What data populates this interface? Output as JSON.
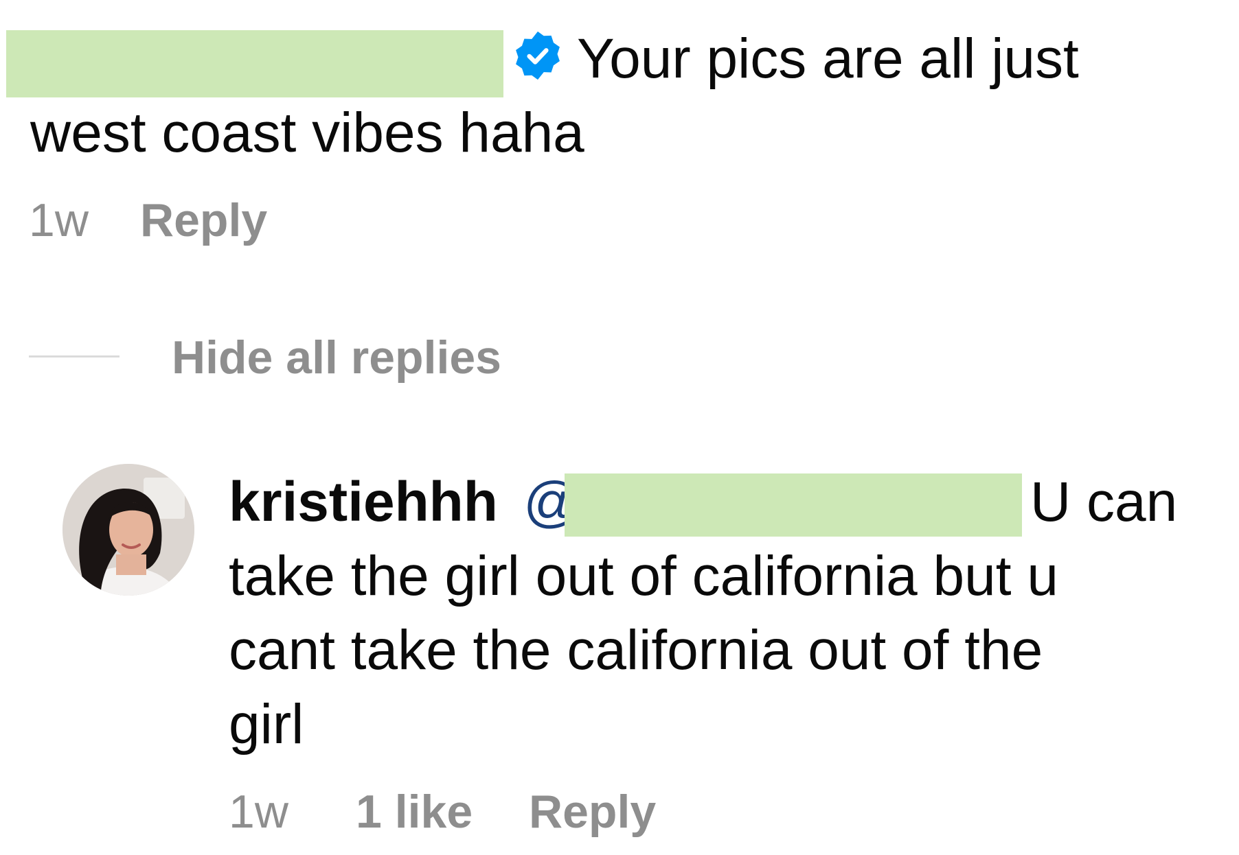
{
  "comment": {
    "text_line1": "Your pics are all just",
    "text_line2": "west coast vibes haha",
    "time": "1w",
    "reply_label": "Reply",
    "verified_icon": "verified-badge-icon",
    "verified_color": "#0095f6"
  },
  "replies_toggle": {
    "label": "Hide all replies"
  },
  "reply": {
    "username": "kristiehhh",
    "mention_prefix": "@",
    "text_line1": "U can",
    "text_line2": "take the girl out of california but u",
    "text_line3": "cant take the california out of the",
    "text_line4": "girl",
    "time": "1w",
    "likes": "1 like",
    "reply_label": "Reply"
  },
  "colors": {
    "redaction": "#cde8b6",
    "muted": "#8e8e8e",
    "mention": "#1b3f7a"
  }
}
